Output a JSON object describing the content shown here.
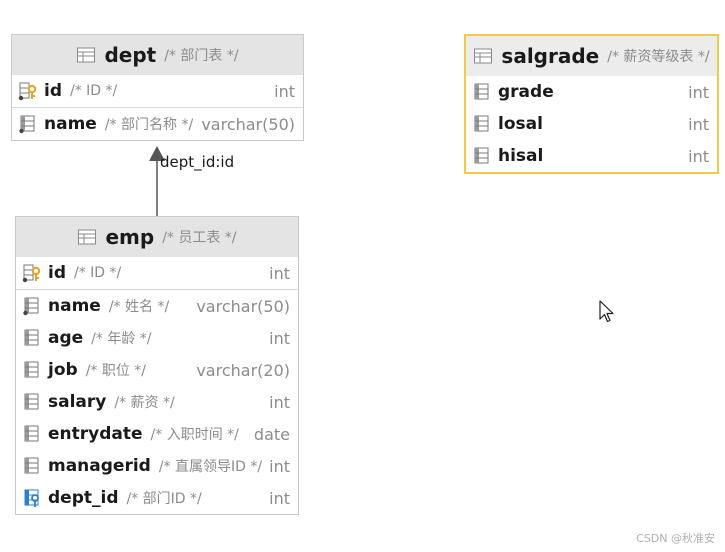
{
  "dept": {
    "name": "dept",
    "comment": "/* 部门表 */",
    "columns": [
      {
        "name": "id",
        "comment": "/* ID */",
        "type": "int",
        "icon": "primary-key-column-icon"
      },
      {
        "name": "name",
        "comment": "/* 部门名称 */",
        "type": "varchar(50)",
        "icon": "column-icon"
      }
    ]
  },
  "emp": {
    "name": "emp",
    "comment": "/* 员工表 */",
    "columns": [
      {
        "name": "id",
        "comment": "/* ID */",
        "type": "int",
        "icon": "primary-key-column-icon"
      },
      {
        "name": "name",
        "comment": "/* 姓名 */",
        "type": "varchar(50)",
        "icon": "column-icon"
      },
      {
        "name": "age",
        "comment": "/* 年龄 */",
        "type": "int",
        "icon": "column-icon"
      },
      {
        "name": "job",
        "comment": "/* 职位 */",
        "type": "varchar(20)",
        "icon": "column-icon"
      },
      {
        "name": "salary",
        "comment": "/* 薪资 */",
        "type": "int",
        "icon": "column-icon"
      },
      {
        "name": "entrydate",
        "comment": "/* 入职时间 */",
        "type": "date",
        "icon": "column-icon"
      },
      {
        "name": "managerid",
        "comment": "/* 直属领导ID */",
        "type": "int",
        "icon": "column-icon"
      },
      {
        "name": "dept_id",
        "comment": "/* 部门ID */",
        "type": "int",
        "icon": "foreign-key-column-icon"
      }
    ]
  },
  "salgrade": {
    "name": "salgrade",
    "comment": "/* 薪资等级表 */",
    "columns": [
      {
        "name": "grade",
        "comment": "",
        "type": "int",
        "icon": "column-icon"
      },
      {
        "name": "losal",
        "comment": "",
        "type": "int",
        "icon": "column-icon"
      },
      {
        "name": "hisal",
        "comment": "",
        "type": "int",
        "icon": "column-icon"
      }
    ]
  },
  "relation": {
    "label": "dept_id:id"
  },
  "watermark": "CSDN @秋准安",
  "colors": {
    "selected_border": "#f2c94c",
    "header_bg": "#e4e4e4",
    "fk_icon": "#2f7fd0",
    "pk_icon": "#e0a526"
  }
}
